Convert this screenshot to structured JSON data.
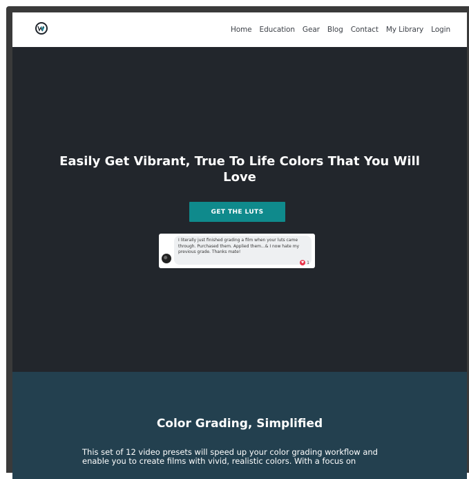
{
  "nav": {
    "logo_icon": "wm-logo-icon",
    "links": [
      "Home",
      "Education",
      "Gear",
      "Blog",
      "Contact",
      "My Library",
      "Login"
    ]
  },
  "hero": {
    "title_line1": "Easily Get Vibrant, True To Life Colors That You Will",
    "title_line2": "Love",
    "cta_label": "GET THE LUTS",
    "testimonial": {
      "text": "I literally just finished grading a film when your luts came through. Purchased them. Applied them...& I now hate my previous grade. Thanks mate!",
      "reaction_count": "1",
      "reaction_icon": "heart-icon"
    }
  },
  "feature": {
    "title": "Color Grading, Simplified",
    "text": "This set of 12 video presets will speed up your color grading workflow and enable you to create films with vivid, realistic colors. With a focus on"
  },
  "colors": {
    "nav_bg": "#ffffff",
    "hero_bg": "#22262c",
    "cta_bg": "#0f8a8c",
    "feature_bg": "#23404f"
  }
}
